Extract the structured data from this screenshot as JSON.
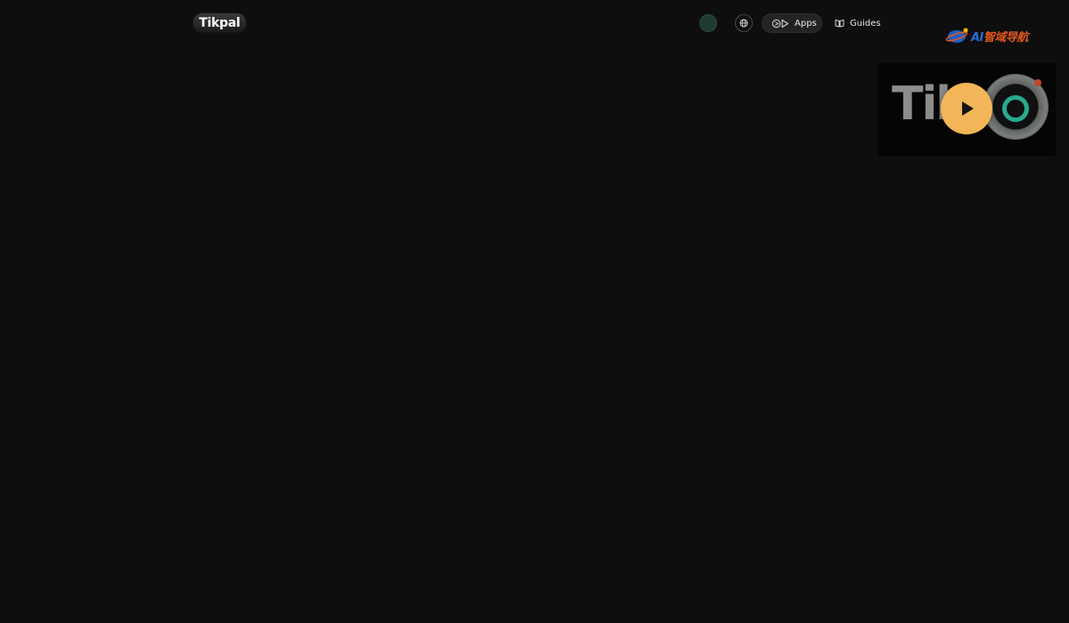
{
  "header": {
    "logo_text": "Tikpal",
    "nav": {
      "apps_label": "Apps",
      "guides_label": "Guides"
    },
    "icons": {
      "globe": "globe-icon",
      "apps": "apps-icon",
      "guides": "book-icon"
    }
  },
  "watermark": {
    "ai": "AI",
    "text": "智域导航"
  },
  "video": {
    "logo_text": "Tik",
    "play_color": "#f2b558"
  }
}
